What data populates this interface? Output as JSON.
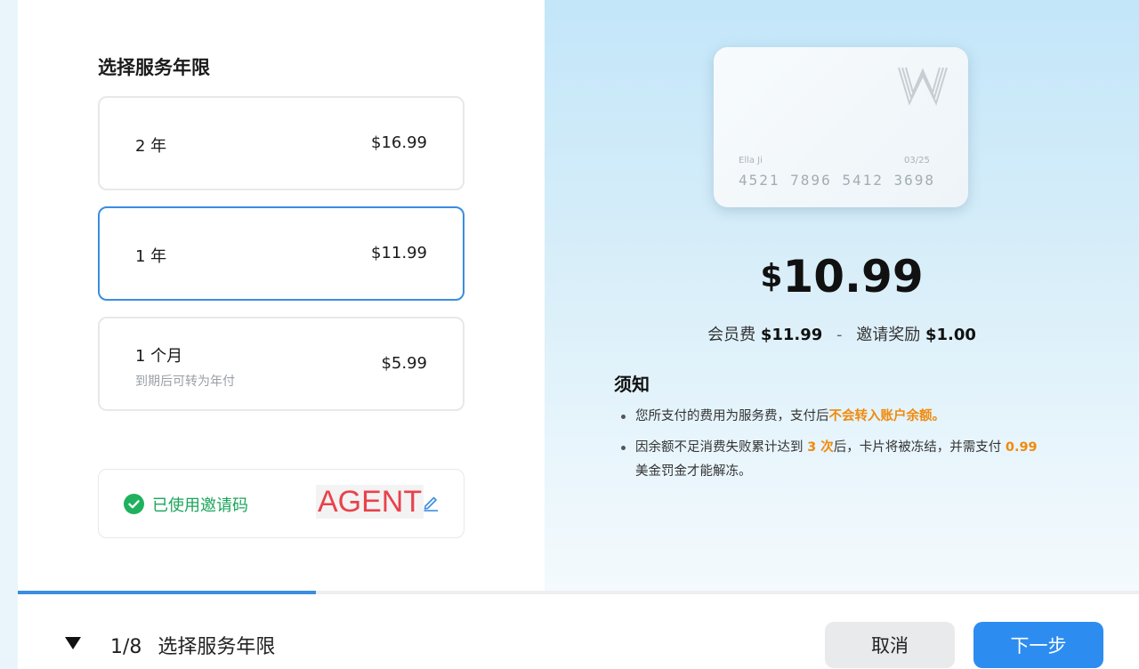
{
  "left": {
    "title": "选择服务年限",
    "plans": [
      {
        "name": "2 年",
        "price": "$16.99",
        "sub": ""
      },
      {
        "name": "1 年",
        "price": "$11.99",
        "sub": ""
      },
      {
        "name": "1 个月",
        "price": "$5.99",
        "sub": "到期后可转为年付"
      }
    ],
    "selected_plan": "1 年",
    "invite": {
      "label": "已使用邀请码",
      "code": "AGENT"
    }
  },
  "card": {
    "holder": "Ella Ji",
    "expiry": "03/25",
    "number": "4521 7896 5412 3698"
  },
  "summary": {
    "currency": "$",
    "amount": "10.99",
    "fee_label": "会员费",
    "fee_value": "$11.99",
    "separator": "-",
    "reward_label": "邀请奖励",
    "reward_value": "$1.00"
  },
  "notice": {
    "title": "须知",
    "item1_text": "您所支付的费用为服务费，支付后",
    "item1_highlight": "不会转入账户余额。",
    "item2_text_a": "因余额不足消费失败累计达到",
    "item2_highlight_a": "3 次",
    "item2_text_b": "后，卡片将被冻结，并需支付",
    "item2_highlight_b": "0.99",
    "item2_text_c": "美金罚金才能解冻。"
  },
  "progress": {
    "current": 1,
    "total": 8,
    "fraction": 0.125
  },
  "footer": {
    "step": "1/8",
    "step_title": "选择服务年限",
    "cancel_label": "取消",
    "next_label": "下一步"
  },
  "colors": {
    "accent": "#2d8cf0",
    "success": "#1fb15e",
    "highlight": "#f08a0c",
    "invite_code": "#e8424c"
  }
}
